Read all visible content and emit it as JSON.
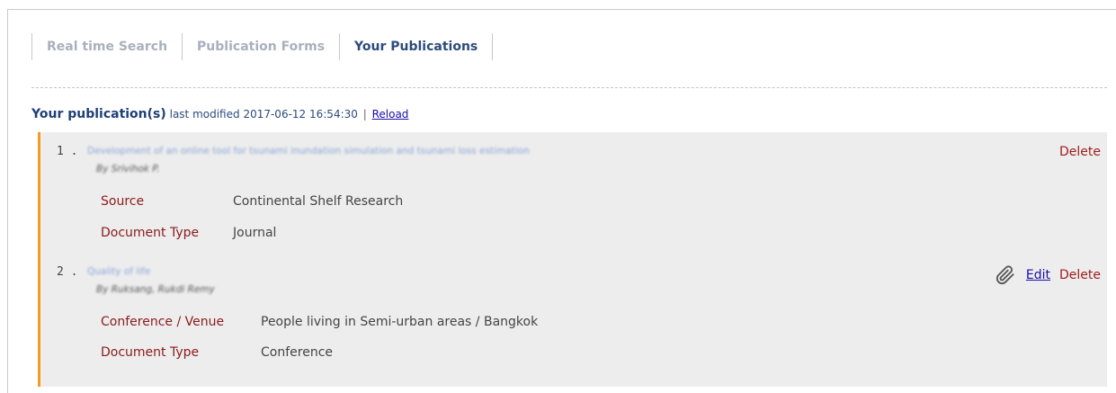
{
  "tabs": [
    {
      "label": "Real time Search",
      "active": false
    },
    {
      "label": "Publication Forms",
      "active": false
    },
    {
      "label": "Your Publications",
      "active": true
    }
  ],
  "heading": {
    "title": "Your publication(s)",
    "modified_prefix": "last modified",
    "modified_at": "2017-06-12 16:54:30",
    "separator": "|",
    "reload_label": "Reload"
  },
  "publications": [
    {
      "number": "1 .",
      "title": "Development of an online tool for tsunami inundation simulation and tsunami loss estimation",
      "author": "By Srivihok P.",
      "fields": [
        {
          "label": "Source",
          "value": "Continental Shelf Research"
        },
        {
          "label": "Document Type",
          "value": "Journal"
        }
      ],
      "actions": {
        "delete": "Delete"
      }
    },
    {
      "number": "2 .",
      "title": "Quality of life",
      "author": "By Ruksang, Rukdi Remy",
      "fields": [
        {
          "label": "Conference / Venue",
          "value": "People living in Semi-urban areas / Bangkok"
        },
        {
          "label": "Document Type",
          "value": "Conference"
        }
      ],
      "actions": {
        "edit": "Edit",
        "delete": "Delete",
        "attachment_icon": "paperclip-icon"
      }
    }
  ],
  "colors": {
    "accent_border": "#f39c21",
    "panel_bg": "#ededed",
    "field_label": "#8b1b1b",
    "link": "#1a0dab",
    "heading": "#1f3f78"
  }
}
